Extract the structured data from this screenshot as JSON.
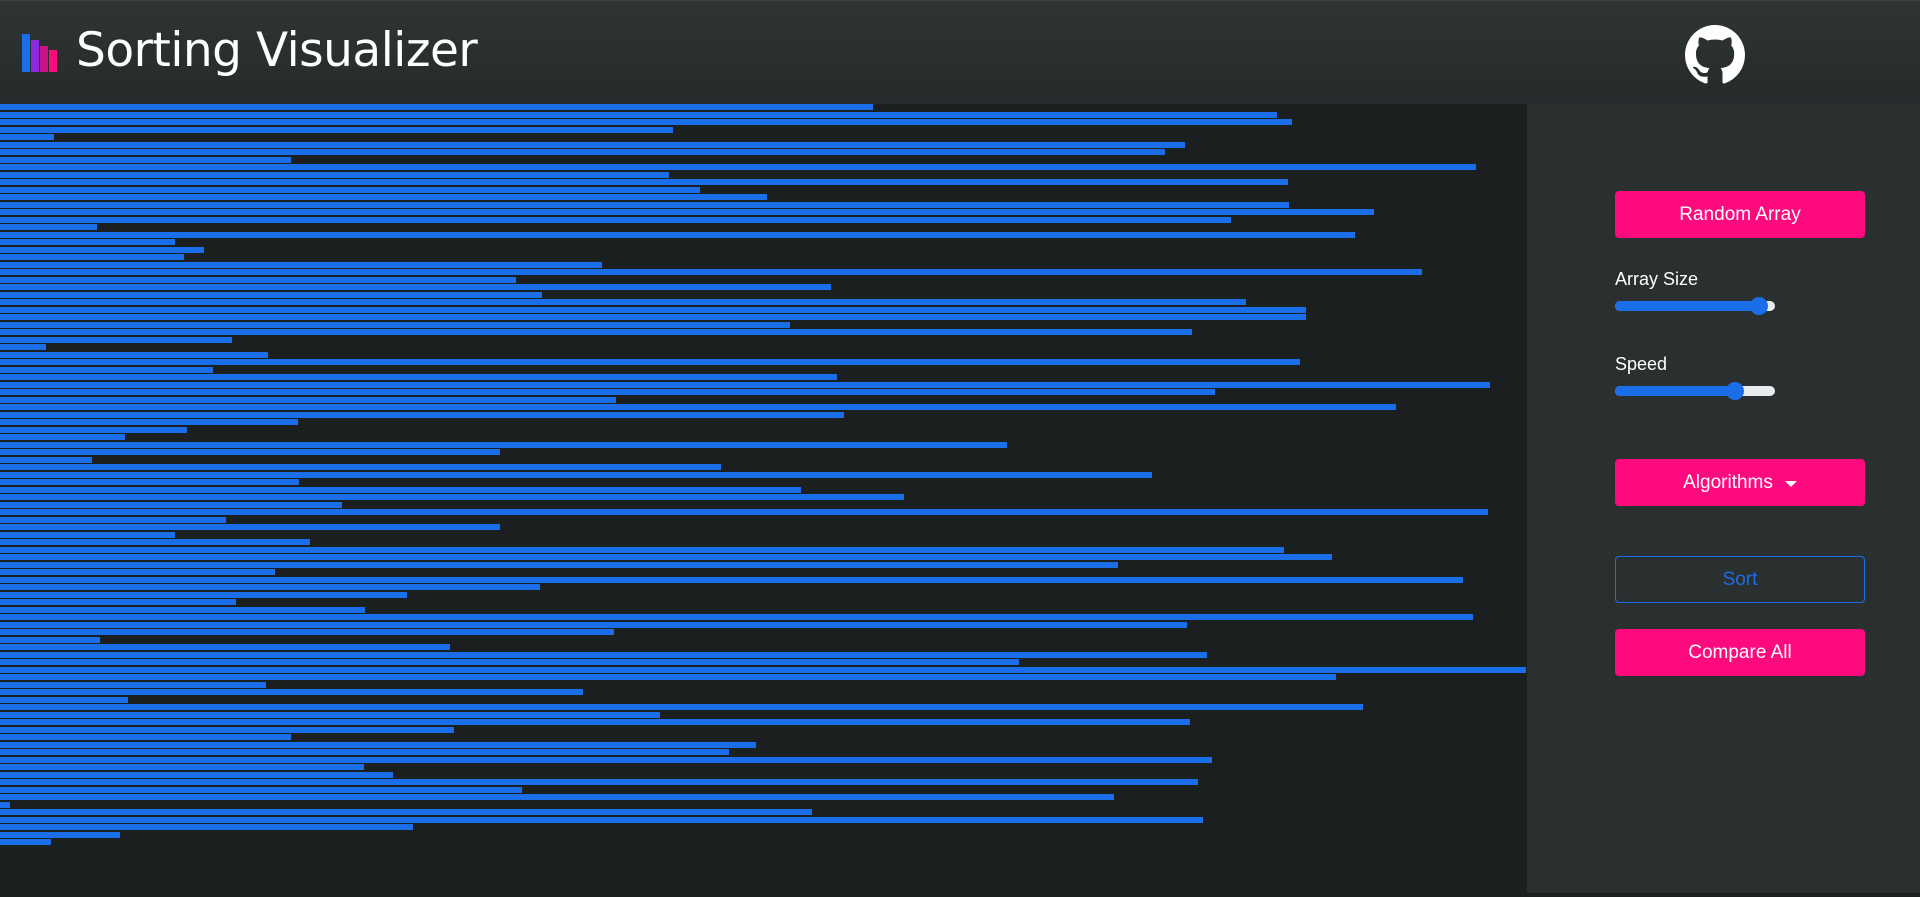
{
  "header": {
    "title": "Sorting Visualizer",
    "logo_icon": "bar-chart-logo-icon",
    "github_icon": "github-icon"
  },
  "colors": {
    "bar": "#1a6ee8",
    "accent": "#fd0a7e",
    "panel": "#2a2f30",
    "background": "#1b1f20"
  },
  "array": {
    "max_value": 1250,
    "values": [
      715,
      1045,
      1058,
      551,
      44,
      970,
      954,
      238,
      1208,
      548,
      1054,
      573,
      628,
      1055,
      1125,
      1008,
      79,
      1109,
      143,
      167,
      151,
      493,
      1164,
      422,
      680,
      444,
      1020,
      1069,
      1069,
      647,
      976,
      190,
      38,
      219,
      1064,
      174,
      685,
      1220,
      995,
      504,
      1143,
      691,
      244,
      153,
      102,
      824,
      409,
      75,
      590,
      943,
      245,
      656,
      740,
      280,
      1218,
      185,
      409,
      143,
      254,
      1051,
      1090,
      915,
      225,
      1198,
      442,
      333,
      193,
      299,
      1206,
      972,
      503,
      82,
      368,
      988,
      834,
      1249,
      1094,
      218,
      477,
      105,
      1116,
      540,
      974,
      372,
      238,
      619,
      597,
      992,
      298,
      322,
      981,
      427,
      912,
      8,
      665,
      985,
      338,
      98,
      42
    ]
  },
  "controls": {
    "random_array_label": "Random Array",
    "array_size_label": "Array Size",
    "array_size_value": 0.9,
    "speed_label": "Speed",
    "speed_value": 0.75,
    "algorithms_label": "Algorithms",
    "sort_label": "Sort",
    "compare_all_label": "Compare All"
  }
}
